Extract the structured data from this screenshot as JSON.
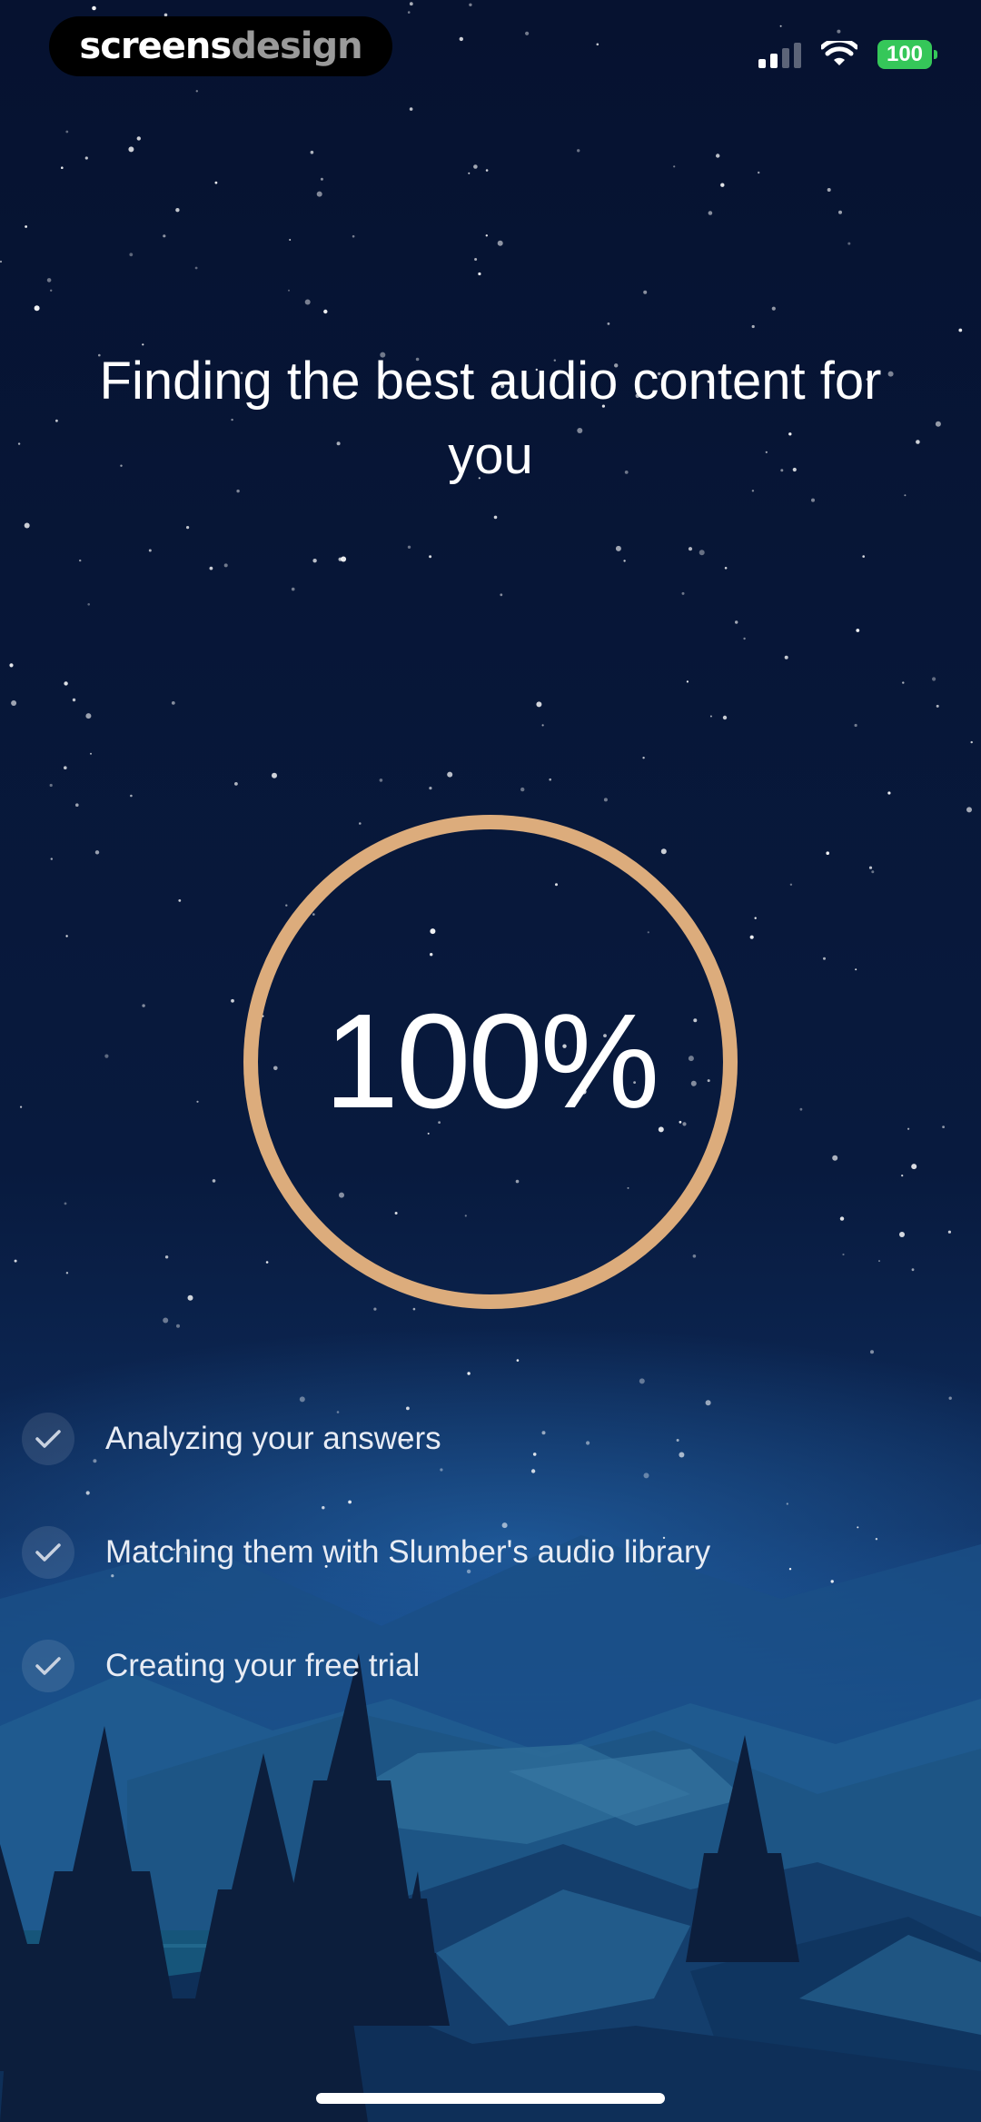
{
  "watermark": {
    "part1": "screens",
    "part2": "design"
  },
  "status_bar": {
    "battery": "100"
  },
  "title": "Finding the best audio content for you",
  "progress": {
    "value": 1.0,
    "label": "100%",
    "ring_color": "#dcac7c"
  },
  "steps": [
    {
      "label": "Analyzing your answers",
      "done": true
    },
    {
      "label": "Matching them with Slumber's audio library",
      "done": true
    },
    {
      "label": "Creating your free trial",
      "done": true
    }
  ],
  "colors": {
    "sky_top": "#061230",
    "sky_mid": "#0a2148",
    "horizon_glow": "#1d5aa8",
    "lake": "#16557a",
    "trees": "#0d1f3d"
  },
  "icons": [
    "signal-icon",
    "wifi-icon",
    "battery-icon",
    "check-icon"
  ]
}
